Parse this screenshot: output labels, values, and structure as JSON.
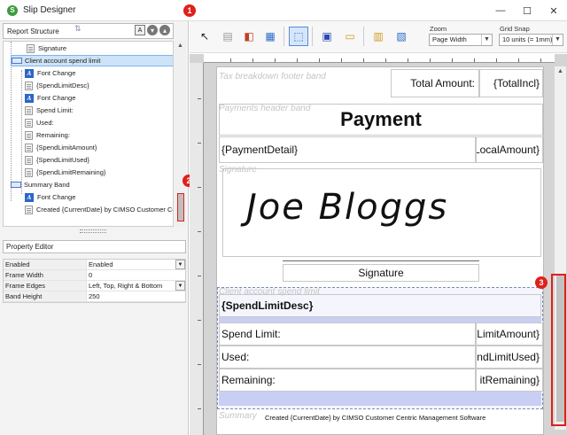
{
  "window": {
    "title": "Slip Designer",
    "callout_1": "1",
    "minimize": "—",
    "maximize": "☐",
    "close": "✕"
  },
  "left_pane": {
    "report_structure_title": "Report Structure",
    "tree": [
      {
        "label": "Signature",
        "icon": "document-icon"
      },
      {
        "label": "Client account spend limit",
        "icon": "band-icon",
        "selected": true
      },
      {
        "label": "Font Change",
        "icon": "font-icon"
      },
      {
        "label": "{SpendLimitDesc}",
        "icon": "document-icon"
      },
      {
        "label": "Font Change",
        "icon": "font-icon"
      },
      {
        "label": "Spend Limit:",
        "icon": "document-icon"
      },
      {
        "label": "Used:",
        "icon": "document-icon"
      },
      {
        "label": "Remaining:",
        "icon": "document-icon"
      },
      {
        "label": "{SpendLimitAmount}",
        "icon": "document-icon"
      },
      {
        "label": "{SpendLimitUsed}",
        "icon": "document-icon"
      },
      {
        "label": "{SpendLimitRemaining}",
        "icon": "document-icon"
      },
      {
        "label": "Summary Band",
        "icon": "band-icon"
      },
      {
        "label": "Font Change",
        "icon": "font-icon"
      },
      {
        "label": "Created {CurrentDate} by CIMSO Customer Centric",
        "icon": "document-icon"
      }
    ],
    "callout_2": "2",
    "property_editor_title": "Property Editor",
    "properties": [
      {
        "name": "Enabled",
        "value": "Enabled",
        "dropdown": true
      },
      {
        "name": "Frame Width",
        "value": "0",
        "dropdown": false
      },
      {
        "name": "Frame Edges",
        "value": "Left, Top, Right & Bottom",
        "dropdown": true
      },
      {
        "name": "Band Height",
        "value": "250",
        "dropdown": false
      }
    ]
  },
  "toolbar": {
    "zoom_label": "Zoom",
    "zoom_value": "Page Width",
    "grid_snap_label": "Grid Snap",
    "grid_snap_value": "10 units (= 1mm)"
  },
  "design": {
    "tax_band_caption": "Tax breakdown footer band",
    "total_amount_label": "Total Amount:",
    "total_incl": "{TotalIncl}",
    "payments_band_caption": "Payments header band",
    "payment_title": "Payment",
    "payment_detail": "{PaymentDetail}",
    "local_amount": "LocalAmount}",
    "signature_band_caption": "Signature",
    "signature_text": "Joe Bloggs",
    "signature_label": "Signature",
    "spend_band_caption": "Client account spend limit",
    "spend_limit_desc": "{SpendLimitDesc}",
    "spend_limit_label": "Spend Limit:",
    "spend_limit_amount": "LimitAmount}",
    "used_label": "Used:",
    "used_amount": "ndLimitUsed}",
    "remaining_label": "Remaining:",
    "remaining_amount": "itRemaining}",
    "summary_band_caption": "Summary",
    "created_text": "Created {CurrentDate} by CIMSO Customer Centric Management Software",
    "callout_3": "3"
  }
}
